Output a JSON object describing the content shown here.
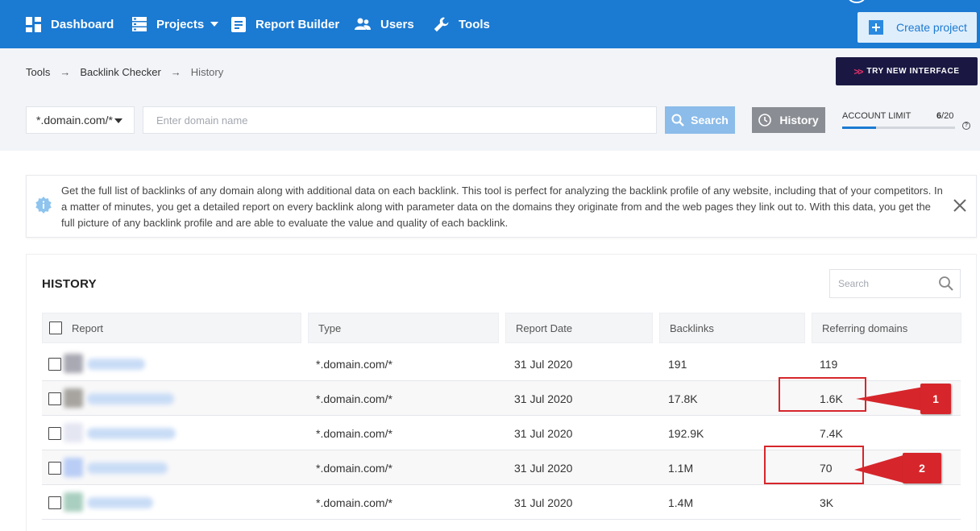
{
  "nav": {
    "items": [
      {
        "label": "Dashboard",
        "icon": "dashboard-icon"
      },
      {
        "label": "Projects",
        "icon": "projects-icon"
      },
      {
        "label": "Report Builder",
        "icon": "report-icon"
      },
      {
        "label": "Users",
        "icon": "users-icon"
      },
      {
        "label": "Tools",
        "icon": "wrench-icon"
      }
    ],
    "create_label": "Create project"
  },
  "breadcrumb": {
    "items": [
      "Tools",
      "Backlink Checker",
      "History"
    ],
    "separator": "→"
  },
  "try_new": {
    "label": "TRY NEW INTERFACE"
  },
  "search_bar": {
    "mode": "*.domain.com/*",
    "placeholder": "Enter domain name",
    "search_label": "Search",
    "history_label": "History"
  },
  "account_limit": {
    "label": "ACCOUNT LIMIT",
    "used": "6",
    "total": "/20",
    "used_fraction": 0.3
  },
  "info": {
    "text": "Get the full list of backlinks of any domain along with additional data on each backlink. This tool is perfect for analyzing the backlink profile of any website, including that of your competitors. In a matter of minutes, you get a detailed report on every backlink along with parameter data on the domains they originate from and the web pages they link out to. With this data, you get the full picture of any backlink profile and are able to evaluate the value and quality of each backlink."
  },
  "history": {
    "title": "HISTORY",
    "search_placeholder": "Search",
    "columns": [
      "Report",
      "Type",
      "Report Date",
      "Backlinks",
      "Referring domains"
    ],
    "rows": [
      {
        "type": "*.domain.com/*",
        "date": "31 Jul 2020",
        "backlinks": "191",
        "referring": "119"
      },
      {
        "type": "*.domain.com/*",
        "date": "31 Jul 2020",
        "backlinks": "17.8K",
        "referring": "1.6K"
      },
      {
        "type": "*.domain.com/*",
        "date": "31 Jul 2020",
        "backlinks": "192.9K",
        "referring": "7.4K"
      },
      {
        "type": "*.domain.com/*",
        "date": "31 Jul 2020",
        "backlinks": "1.1M",
        "referring": "70"
      },
      {
        "type": "*.domain.com/*",
        "date": "31 Jul 2020",
        "backlinks": "1.4M",
        "referring": "3K"
      }
    ]
  },
  "annotations": {
    "first": "1",
    "second": "2"
  },
  "colors": {
    "nav_bg": "#1b7ad2",
    "try_btn_bg": "#1a1842",
    "annotation_red": "#d6262b"
  }
}
